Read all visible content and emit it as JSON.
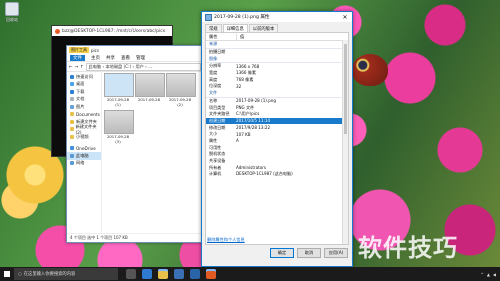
{
  "desktop": {
    "icon_label": "回收站"
  },
  "cmd": {
    "title": "bzz@DESKTOP-1CL987: /mnt/c/Users/abc/pics"
  },
  "explorer": {
    "title_tab": "图片工具",
    "title_sub": "pics",
    "ribbon": [
      "文件",
      "主页",
      "共享",
      "查看",
      "管理"
    ],
    "address": "此电脑 › 本地磁盘 (C:) › 用户 › ...",
    "nav_items": [
      "快速访问",
      "桌面",
      "下载",
      "文档",
      "图片",
      "Documents",
      "新建文件夹",
      "新建文件夹 (2)",
      "小视频"
    ],
    "nav_extra": [
      "OneDrive",
      "此电脑",
      "网络"
    ],
    "thumbs": [
      "2017-09-28 (1)",
      "2017-09-28",
      "2017-09-28 (2)",
      "2017-09-28 (3)"
    ],
    "status": "4 个项目  选中 1 个项目  107 KB"
  },
  "properties": {
    "title": "2017-09-28 (1).png 属性",
    "tabs": [
      "常规",
      "详细信息",
      "以前的版本"
    ],
    "col_prop": "属性",
    "col_val": "值",
    "rows": [
      {
        "k": "来源",
        "v": "",
        "section": true
      },
      {
        "k": "拍摄日期",
        "v": ""
      },
      {
        "k": "图像",
        "v": "",
        "section": true
      },
      {
        "k": "分辨率",
        "v": "1366 x 768"
      },
      {
        "k": "宽度",
        "v": "1366 像素"
      },
      {
        "k": "高度",
        "v": "768 像素"
      },
      {
        "k": "位深度",
        "v": "32"
      },
      {
        "k": "文件",
        "v": "",
        "section": true
      },
      {
        "k": "名称",
        "v": "2017-09-28 (1).png"
      },
      {
        "k": "项目类型",
        "v": "PNG 文件"
      },
      {
        "k": "文件夹路径",
        "v": "C:\\用户\\pics"
      },
      {
        "k": "创建日期",
        "v": "2017/10/5 11:14",
        "selected": true
      },
      {
        "k": "修改日期",
        "v": "2017/9/28 13:22"
      },
      {
        "k": "大小",
        "v": "107 KB"
      },
      {
        "k": "属性",
        "v": "A"
      },
      {
        "k": "可用性",
        "v": ""
      },
      {
        "k": "脱机状态",
        "v": ""
      },
      {
        "k": "共享设备",
        "v": ""
      },
      {
        "k": "所有者",
        "v": "Administrators"
      },
      {
        "k": "计算机",
        "v": "DESKTOP-1CL987 (这台电脑)"
      }
    ],
    "link": "删除属性和个人信息",
    "buttons": [
      "确定",
      "取消",
      "应用(A)"
    ]
  },
  "watermark": "软件技巧",
  "taskbar": {
    "search_placeholder": "在这里输入你要搜索的内容"
  },
  "colors": {
    "accent": "#1979ca",
    "taskbar": "#1b1b1b"
  }
}
